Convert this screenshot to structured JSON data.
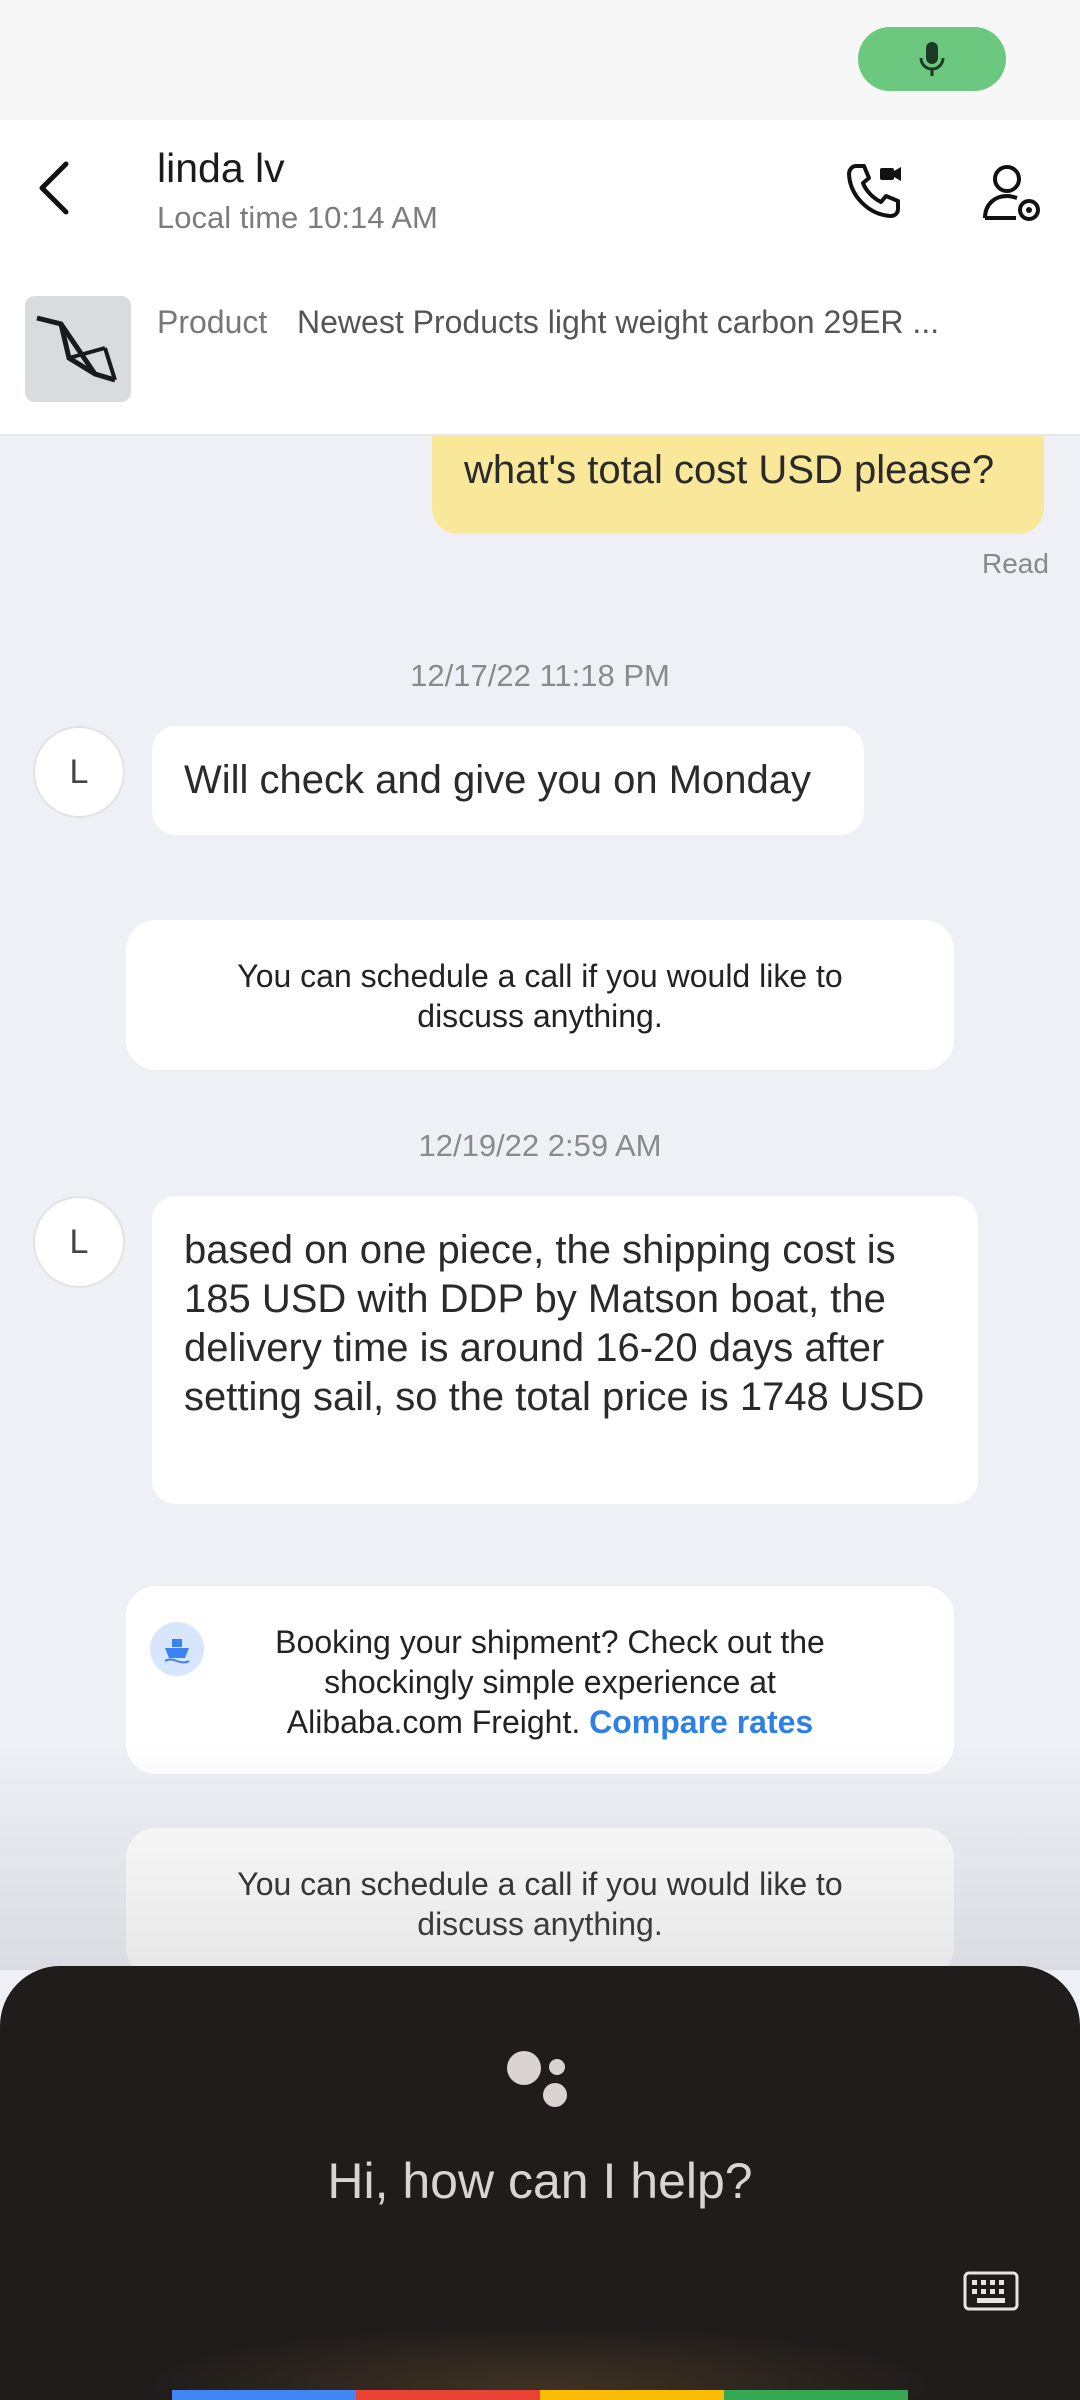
{
  "header": {
    "contact_name": "linda lv",
    "local_time": "Local time 10:14 AM"
  },
  "product": {
    "label": "Product",
    "title": "Newest Products light weight carbon 29ER ..."
  },
  "messages": {
    "outgoing_1": {
      "text": "what's total cost USD please?",
      "status": "Read"
    },
    "timestamp_1": "12/17/22 11:18 PM",
    "incoming_1": {
      "avatar_initial": "L",
      "text": "Will check and give you on Monday"
    },
    "system_1": "You can schedule a call if you would like to discuss anything.",
    "timestamp_2": "12/19/22 2:59 AM",
    "incoming_2": {
      "avatar_initial": "L",
      "text": "based on one piece,  the shipping cost is 185 USD with DDP by Matson boat, the delivery time is around 16-20 days after setting sail, so the total price is 1748 USD"
    },
    "freight_card": {
      "text": "Booking your shipment? Check out the shockingly simple experience at Alibaba.com Freight.",
      "link": "Compare rates"
    },
    "system_2": "You can schedule a call if you would like to discuss anything."
  },
  "assistant": {
    "prompt": "Hi, how can I help?"
  },
  "colors": {
    "accent_green": "#6cc87e",
    "outgoing_bubble": "#f9e79a",
    "link_blue": "#2e7fe6",
    "assistant_bg": "#201c1b",
    "bar_blue": "#4285f4",
    "bar_red": "#ea4335",
    "bar_yellow": "#fbbc05",
    "bar_green": "#34a853"
  },
  "icons": [
    "microphone-icon",
    "back-arrow-icon",
    "video-call-icon",
    "contact-settings-icon",
    "ship-icon",
    "assistant-logo-icon",
    "keyboard-icon"
  ]
}
